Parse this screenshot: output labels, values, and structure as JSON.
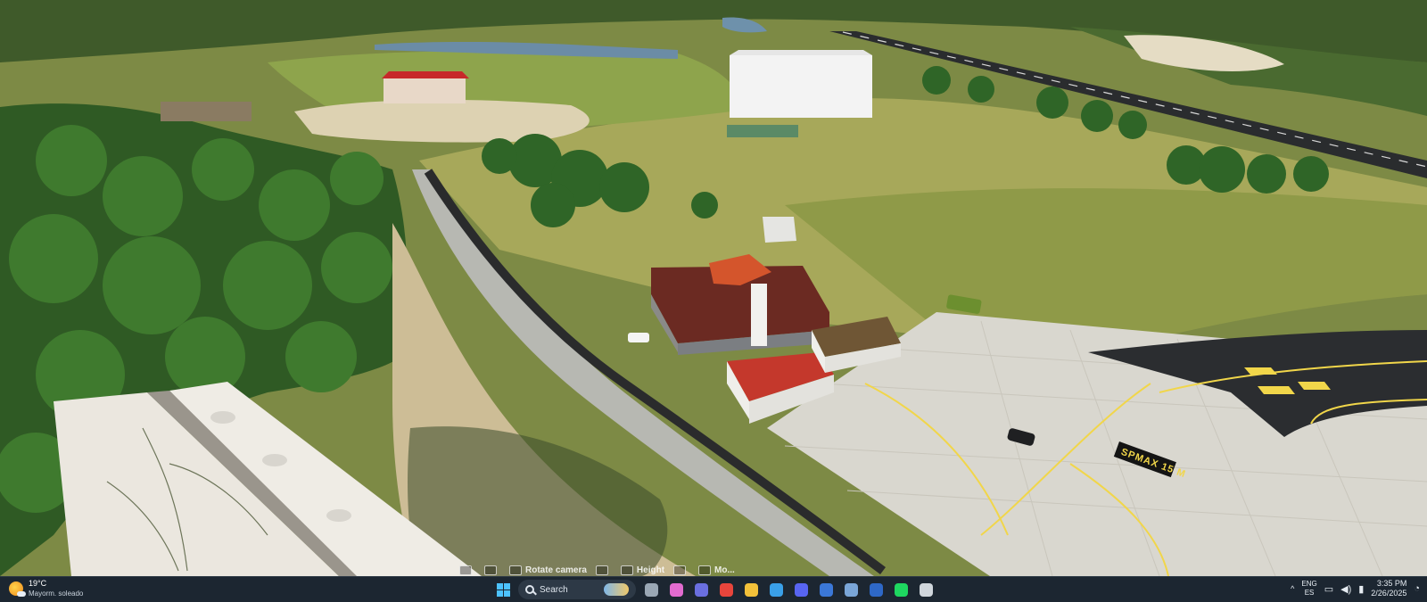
{
  "scene": {
    "runway_marking": "SPMAX 15 M",
    "sky_time": "daytime"
  },
  "hud": {
    "hints": [
      {
        "key": "",
        "label": ""
      },
      {
        "key": "",
        "label": ""
      },
      {
        "key": "",
        "label": "Rotate camera"
      },
      {
        "key": "",
        "label": ""
      },
      {
        "key": "",
        "label": "Height"
      },
      {
        "key": "",
        "label": ""
      },
      {
        "key": "",
        "label": "Mo..."
      }
    ]
  },
  "taskbar": {
    "weather": {
      "temp": "19°C",
      "desc": "Mayorm. soleado",
      "icon": "sun-cloud-icon"
    },
    "search": {
      "placeholder": "Search"
    },
    "pinned_apps": [
      {
        "name": "task-view-icon",
        "color": "#9aa7b4"
      },
      {
        "name": "copilot-icon",
        "color": "#e26bd0"
      },
      {
        "name": "teams-icon",
        "color": "#6a6fe0"
      },
      {
        "name": "chrome-icon",
        "color": "#e8453c"
      },
      {
        "name": "file-explorer-icon",
        "color": "#f3c13a"
      },
      {
        "name": "store-icon",
        "color": "#3aa0e8"
      },
      {
        "name": "discord-icon",
        "color": "#5865f2"
      },
      {
        "name": "app-icon",
        "color": "#3b78d8"
      },
      {
        "name": "flight-sim-icon",
        "color": "#7aa6d8"
      },
      {
        "name": "app-icon",
        "color": "#2e68c7"
      },
      {
        "name": "spotify-icon",
        "color": "#1ed760"
      },
      {
        "name": "app-icon",
        "color": "#d0d6dc"
      }
    ],
    "tray": {
      "lang_top": "ENG",
      "lang_bottom": "ES",
      "time": "3:35 PM",
      "date": "2/26/2025"
    }
  },
  "colors": {
    "taskbar": "#1c2631",
    "accent": "#4cc2ff",
    "apron": "#d9d7cf",
    "runway": "#2b2d30",
    "taxi_line": "#f1d64a"
  }
}
